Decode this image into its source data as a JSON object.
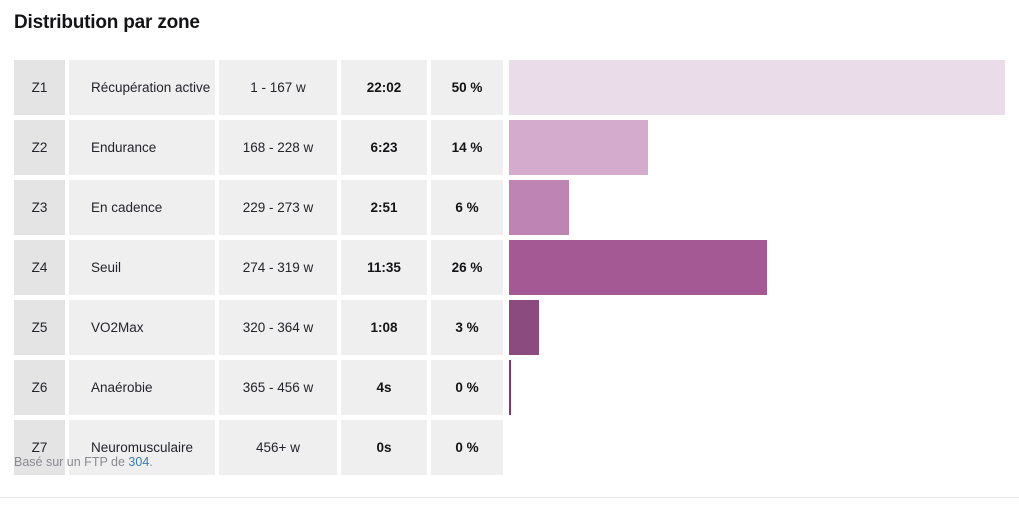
{
  "panel": {
    "title": "Distribution par zone",
    "footnote_prefix": "Basé sur un FTP de ",
    "footnote_value": "304",
    "footnote_suffix": "."
  },
  "colors": {
    "cell_background": "#efefef",
    "zone_cell_background": "#e4e4e4",
    "text": "#23232a",
    "link": "#3b7bbf",
    "muted_text": "#8a8a92"
  },
  "chart_data": {
    "type": "bar",
    "title": "Distribution par zone",
    "orientation": "horizontal",
    "xlabel": "",
    "ylabel": "",
    "value_unit": "%",
    "xlim": [
      0,
      50
    ],
    "grid": false,
    "legend": "none",
    "categories": [
      "Z1",
      "Z2",
      "Z3",
      "Z4",
      "Z5",
      "Z6",
      "Z7"
    ],
    "values": [
      50,
      14,
      6,
      26,
      3,
      0,
      0
    ],
    "bar_colors": [
      "#ebdcea",
      "#d5abcd",
      "#be85b4",
      "#a55994",
      "#8c4b7e",
      "#7a3a6e",
      "#7a3a6e"
    ],
    "rows": [
      {
        "zone": "Z1",
        "name": "Récupération active",
        "power": "1 - 167 w",
        "time": "22:02",
        "percent": "50 %",
        "value": 50,
        "color": "#ebdcea"
      },
      {
        "zone": "Z2",
        "name": "Endurance",
        "power": "168 - 228 w",
        "time": "6:23",
        "percent": "14 %",
        "value": 14,
        "color": "#d5abcd"
      },
      {
        "zone": "Z3",
        "name": "En cadence",
        "power": "229 - 273 w",
        "time": "2:51",
        "percent": "6 %",
        "value": 6,
        "color": "#be85b4"
      },
      {
        "zone": "Z4",
        "name": "Seuil",
        "power": "274 - 319 w",
        "time": "11:35",
        "percent": "26 %",
        "value": 26,
        "color": "#a55994"
      },
      {
        "zone": "Z5",
        "name": "VO2Max",
        "power": "320 - 364 w",
        "time": "1:08",
        "percent": "3 %",
        "value": 3,
        "color": "#8c4b7e"
      },
      {
        "zone": "Z6",
        "name": "Anaérobie",
        "power": "365 - 456 w",
        "time": "4s",
        "percent": "0 %",
        "value": 0.2,
        "color": "#7a3a6e"
      },
      {
        "zone": "Z7",
        "name": "Neuromusculaire",
        "power": "456+ w",
        "time": "0s",
        "percent": "0 %",
        "value": 0,
        "color": "#7a3a6e"
      }
    ]
  }
}
